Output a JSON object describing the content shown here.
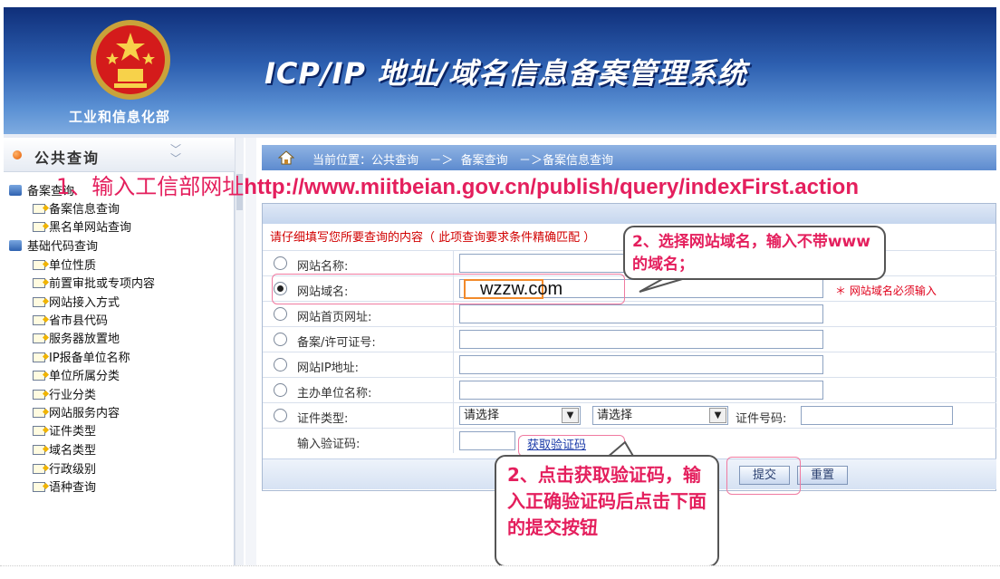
{
  "header": {
    "system_title": "ICP/IP 地址/域名信息备案管理系统",
    "ministry": "工业和信息化部",
    "emblem_icon": "national-emblem-icon"
  },
  "sidebar": {
    "title": "公共查询",
    "chevron_icon": "double-chevron-down-icon",
    "groups": [
      {
        "label": "备案查询",
        "items": [
          "备案信息查询",
          "黑名单网站查询"
        ]
      },
      {
        "label": "基础代码查询",
        "items": [
          "单位性质",
          "前置审批或专项内容",
          "网站接入方式",
          "省市县代码",
          "服务器放置地",
          "IP报备单位名称",
          "单位所属分类",
          "行业分类",
          "网站服务内容",
          "证件类型",
          "域名类型",
          "行政级别",
          "语种查询"
        ]
      }
    ]
  },
  "breadcrumb": {
    "text": "当前位置：公共查询   －＞  备案查询   －＞备案信息查询",
    "home_icon": "home-icon"
  },
  "form": {
    "prompt": "请仔细填写您所要查询的内容（ 此项查询要求条件精确匹配 ）",
    "fields": [
      {
        "label": "网站名称:",
        "checked": false
      },
      {
        "label": "网站域名:",
        "checked": true,
        "value": "wzzw.com",
        "required_note": "＊ 网站域名必须输入"
      },
      {
        "label": "网站首页网址:",
        "checked": false
      },
      {
        "label": "备案/许可证号:",
        "checked": false
      },
      {
        "label": "网站IP地址:",
        "checked": false
      },
      {
        "label": "主办单位名称:",
        "checked": false
      },
      {
        "label": "证件类型:",
        "checked": false
      }
    ],
    "select1": "请选择",
    "select2": "请选择",
    "cert_number_label": "证件号码:",
    "captcha_label": "输入验证码:",
    "captcha_link": "获取验证码",
    "submit": "提交",
    "reset": "重置"
  },
  "annotations": {
    "step1_prefix": "1、输入工信部网址",
    "step1_url": "http://www.miitbeian.gov.cn/publish/query/indexFirst.action",
    "step2a": "2、选择网站域名，输入不带www的域名；",
    "step2b": "2、点击获取验证码，输入正确验证码后点击下面的提交按钮"
  },
  "colors": {
    "annotation": "#e41f5d",
    "banner": "#2d5fb0",
    "required": "#e0001b"
  }
}
